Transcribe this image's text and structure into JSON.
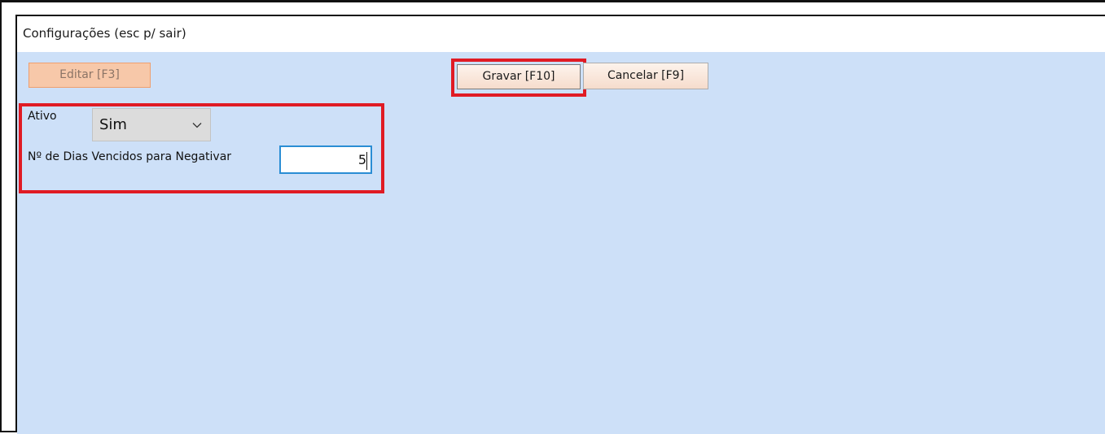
{
  "window": {
    "title": "Configurações (esc p/ sair)"
  },
  "toolbar": {
    "edit_label": "Editar [F3]",
    "save_label": "Gravar [F10]",
    "cancel_label": "Cancelar [F9]"
  },
  "form": {
    "active_label": "Ativo",
    "active_value": "Sim",
    "days_label": "Nº de Dias Vencidos para Negativar",
    "days_value": "5"
  },
  "colors": {
    "content_background": "#cde0f8",
    "highlight": "#e01b24",
    "button_background": "#f6dccc",
    "disabled_button_background": "#f7c8a9",
    "input_focus_border": "#2a8dd4"
  },
  "icons": {
    "select_arrow": "chevron-down-icon"
  }
}
